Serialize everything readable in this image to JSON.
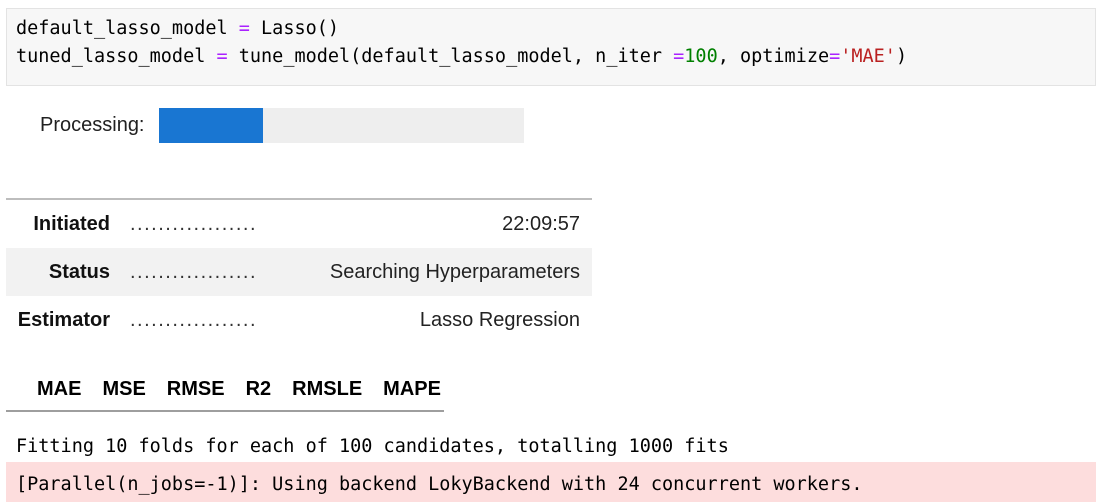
{
  "code": {
    "line1": {
      "var": "default_lasso_model ",
      "op": "=",
      "rest": " Lasso()"
    },
    "line2": {
      "var": "tuned_lasso_model ",
      "op": "=",
      "call": " tune_model(default_lasso_model, n_iter ",
      "op2": "=",
      "num": "100",
      "mid": ", optimize",
      "op3": "=",
      "str": "'MAE'",
      "end": ")"
    }
  },
  "processing": {
    "label": "Processing:",
    "progress_fraction": 0.285
  },
  "status": [
    {
      "key": "Initiated",
      "dots": "..................",
      "value": "22:09:57"
    },
    {
      "key": "Status",
      "dots": "..................",
      "value": "Searching Hyperparameters"
    },
    {
      "key": "Estimator",
      "dots": "..................",
      "value": "Lasso Regression"
    }
  ],
  "metrics": [
    "MAE",
    "MSE",
    "RMSE",
    "R2",
    "RMSLE",
    "MAPE"
  ],
  "output": {
    "stdout": "Fitting 10 folds for each of 100 candidates, totalling 1000 fits",
    "stderr": "[Parallel(n_jobs=-1)]: Using backend LokyBackend with 24 concurrent workers."
  },
  "colors": {
    "progress_fill": "#1976d2",
    "progress_track": "#eeeeee",
    "stderr_bg": "#fddddd"
  }
}
